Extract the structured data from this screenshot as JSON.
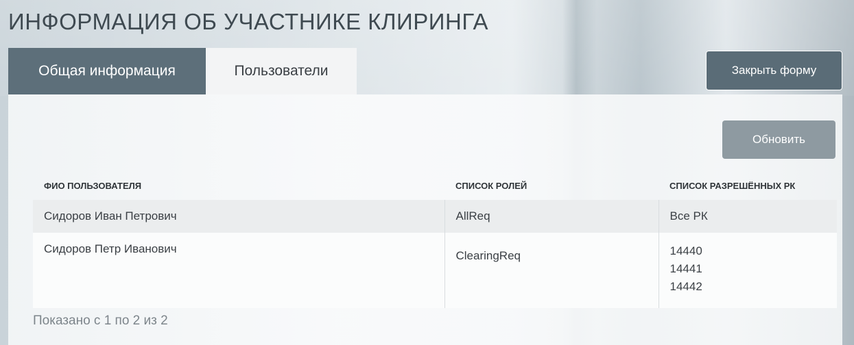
{
  "page": {
    "title": "ИНФОРМАЦИЯ ОБ УЧАСТНИКЕ КЛИРИНГА"
  },
  "tabs": [
    {
      "label": "Общая информация",
      "active": false
    },
    {
      "label": "Пользователи",
      "active": true
    }
  ],
  "actions": {
    "close_label": "Закрыть форму",
    "refresh_label": "Обновить"
  },
  "table": {
    "headers": [
      "ФИО ПОЛЬЗОВАТЕЛЯ",
      "СПИСОК РОЛЕЙ",
      "СПИСОК РАЗРЕШЁННЫХ РК"
    ],
    "rows": [
      {
        "name": "Сидоров Иван Петрович",
        "roles": "AllReq",
        "rk": [
          "Все РК"
        ]
      },
      {
        "name": "Сидоров Петр Иванович",
        "roles": "ClearingReq",
        "rk": [
          "14440",
          "14441",
          "14442"
        ]
      }
    ]
  },
  "pagination": {
    "summary": "Показано с 1 по 2 из 2"
  },
  "colors": {
    "tab_inactive_bg": "#5d6f7a",
    "tab_active_bg": "#f3f4f5",
    "button_bg": "#5a6c77",
    "refresh_bg": "#8e9aa1"
  }
}
